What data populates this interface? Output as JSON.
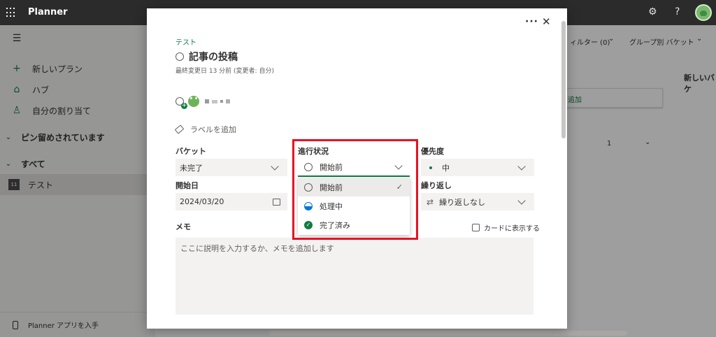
{
  "app": {
    "name": "Planner"
  },
  "sidebar": {
    "items": [
      {
        "label": "新しいプラン",
        "icon": "plus-icon"
      },
      {
        "label": "ハブ",
        "icon": "home-icon"
      },
      {
        "label": "自分の割り当て",
        "icon": "person-icon"
      }
    ],
    "pinned_label": "ピン留めされています",
    "all_label": "すべて",
    "plan_item": {
      "label": "テスト",
      "chip": "11"
    },
    "footer_label": "Planner アプリを入手"
  },
  "board": {
    "filter_label": "ィルター (0)",
    "group_label": "グループ別 バケット",
    "new_bucket": "新しいバケ",
    "add_label": "追加",
    "count": "1"
  },
  "task": {
    "plan_name": "テスト",
    "title": "記事の投稿",
    "modified": "最終変更日 13 分前 (変更者: 自分)",
    "label_add": "ラベルを追加",
    "bucket_label": "バケット",
    "bucket_value": "未完了",
    "status_label": "進行状況",
    "status_value": "開始前",
    "priority_label": "優先度",
    "priority_value": "中",
    "start_label": "開始日",
    "start_value": "2024/03/20",
    "repeat_label": "繰り返し",
    "repeat_value": "繰り返しなし",
    "memo_label": "メモ",
    "memo_placeholder": "ここに説明を入力するか、メモを追加します",
    "show_on_card": "カードに表示する"
  },
  "status_options": [
    {
      "label": "開始前",
      "selected": true
    },
    {
      "label": "処理中",
      "selected": false
    },
    {
      "label": "完了済み",
      "selected": false
    }
  ],
  "colors": {
    "accent": "#107c41",
    "highlight": "#e81123",
    "topbar": "#2b2b2b"
  }
}
